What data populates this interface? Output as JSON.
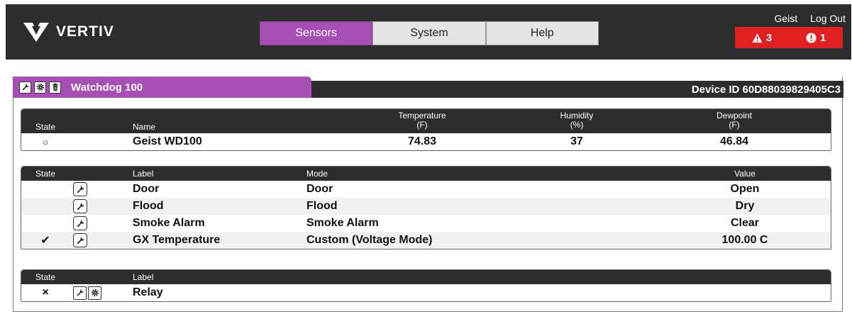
{
  "header": {
    "logo_text": "VERTIV",
    "tabs": [
      {
        "label": "Sensors",
        "active": true
      },
      {
        "label": "System",
        "active": false
      },
      {
        "label": "Help",
        "active": false
      }
    ],
    "user": "Geist",
    "logout": "Log Out",
    "warning_count": "3",
    "alert_count": "1"
  },
  "device": {
    "name": "Watchdog 100",
    "device_id": "Device ID 60D88039829405C3"
  },
  "sensors": {
    "headers": {
      "state": "State",
      "name": "Name",
      "temperature": "Temperature",
      "temperature_unit": "(F)",
      "humidity": "Humidity",
      "humidity_unit": "(%)",
      "dewpoint": "Dewpoint",
      "dewpoint_unit": "(F)"
    },
    "row": {
      "state": "○",
      "name": "Geist WD100",
      "temperature": "74.83",
      "humidity": "37",
      "dewpoint": "46.84"
    }
  },
  "inputs": {
    "headers": {
      "state": "State",
      "label": "Label",
      "mode": "Mode",
      "value": "Value"
    },
    "rows": [
      {
        "state": "",
        "label": "Door",
        "mode": "Door",
        "value": "Open"
      },
      {
        "state": "",
        "label": "Flood",
        "mode": "Flood",
        "value": "Dry"
      },
      {
        "state": "",
        "label": "Smoke Alarm",
        "mode": "Smoke Alarm",
        "value": "Clear"
      },
      {
        "state": "✔",
        "label": "GX Temperature",
        "mode": "Custom (Voltage Mode)",
        "value": "100.00 C"
      }
    ]
  },
  "relays": {
    "headers": {
      "state": "State",
      "label": "Label"
    },
    "rows": [
      {
        "state": "×",
        "label": "Relay"
      }
    ]
  },
  "colors": {
    "accent": "#a84fb5",
    "header_bg": "#2d2d2f",
    "alarm_bg": "#e02020"
  }
}
